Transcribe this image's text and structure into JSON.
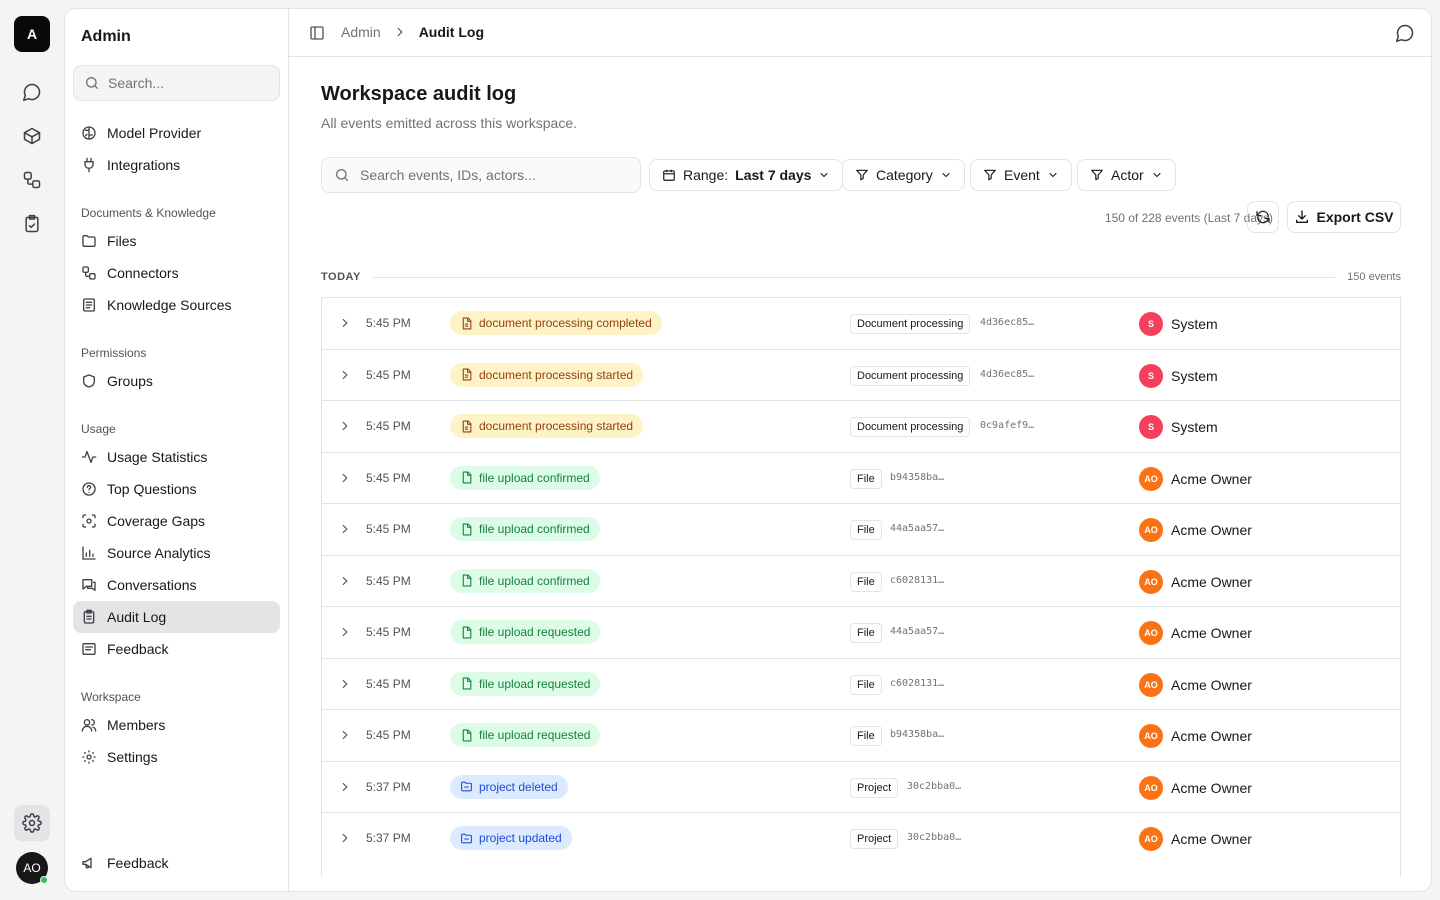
{
  "rail": {
    "logo": "A",
    "avatar": "AO"
  },
  "sidebar": {
    "title": "Admin",
    "search_placeholder": "Search...",
    "top_items": [
      {
        "label": "Model Provider",
        "icon": "brain-icon"
      },
      {
        "label": "Integrations",
        "icon": "plug-icon"
      }
    ],
    "groups": [
      {
        "label": "Documents & Knowledge",
        "items": [
          {
            "label": "Files",
            "icon": "folder-icon"
          },
          {
            "label": "Connectors",
            "icon": "connectors-icon"
          },
          {
            "label": "Knowledge Sources",
            "icon": "book-icon"
          }
        ]
      },
      {
        "label": "Permissions",
        "items": [
          {
            "label": "Groups",
            "icon": "shield-icon"
          }
        ]
      },
      {
        "label": "Usage",
        "items": [
          {
            "label": "Usage Statistics",
            "icon": "activity-icon"
          },
          {
            "label": "Top Questions",
            "icon": "question-icon"
          },
          {
            "label": "Coverage Gaps",
            "icon": "scan-icon"
          },
          {
            "label": "Source Analytics",
            "icon": "bar-chart-icon"
          },
          {
            "label": "Conversations",
            "icon": "messages-icon"
          },
          {
            "label": "Audit Log",
            "icon": "clipboard-icon",
            "active": true
          },
          {
            "label": "Feedback",
            "icon": "feedback-icon"
          }
        ]
      },
      {
        "label": "Workspace",
        "items": [
          {
            "label": "Members",
            "icon": "users-icon"
          },
          {
            "label": "Settings",
            "icon": "gear-icon"
          }
        ]
      }
    ],
    "footer_item": {
      "label": "Feedback",
      "icon": "megaphone-icon"
    }
  },
  "topbar": {
    "breadcrumb_parent": "Admin",
    "breadcrumb_current": "Audit Log"
  },
  "page": {
    "title": "Workspace audit log",
    "subtitle": "All events emitted across this workspace.",
    "search_placeholder": "Search events, IDs, actors...",
    "range_label": "Range:",
    "range_value": "Last 7 days",
    "category_label": "Category",
    "event_label": "Event",
    "actor_label": "Actor",
    "count_text": "150 of 228 events (Last 7 days)",
    "export_label": "Export CSV",
    "group_label": "TODAY",
    "group_count": "150 events"
  },
  "events": [
    {
      "time": "5:45 PM",
      "event": "document processing completed",
      "color": "yellow",
      "resource": "Document processing",
      "resource_id": "4d36ec85…",
      "actor": "System",
      "actor_initials": "S",
      "actor_kind": "sys"
    },
    {
      "time": "5:45 PM",
      "event": "document processing started",
      "color": "yellow",
      "resource": "Document processing",
      "resource_id": "4d36ec85…",
      "actor": "System",
      "actor_initials": "S",
      "actor_kind": "sys"
    },
    {
      "time": "5:45 PM",
      "event": "document processing started",
      "color": "yellow",
      "resource": "Document processing",
      "resource_id": "0c9afef9…",
      "actor": "System",
      "actor_initials": "S",
      "actor_kind": "sys"
    },
    {
      "time": "5:45 PM",
      "event": "file upload confirmed",
      "color": "green",
      "resource": "File",
      "resource_id": "b94358ba…",
      "actor": "Acme Owner",
      "actor_initials": "AO",
      "actor_kind": "ao"
    },
    {
      "time": "5:45 PM",
      "event": "file upload confirmed",
      "color": "green",
      "resource": "File",
      "resource_id": "44a5aa57…",
      "actor": "Acme Owner",
      "actor_initials": "AO",
      "actor_kind": "ao"
    },
    {
      "time": "5:45 PM",
      "event": "file upload confirmed",
      "color": "green",
      "resource": "File",
      "resource_id": "c6028131…",
      "actor": "Acme Owner",
      "actor_initials": "AO",
      "actor_kind": "ao"
    },
    {
      "time": "5:45 PM",
      "event": "file upload requested",
      "color": "green",
      "resource": "File",
      "resource_id": "44a5aa57…",
      "actor": "Acme Owner",
      "actor_initials": "AO",
      "actor_kind": "ao"
    },
    {
      "time": "5:45 PM",
      "event": "file upload requested",
      "color": "green",
      "resource": "File",
      "resource_id": "c6028131…",
      "actor": "Acme Owner",
      "actor_initials": "AO",
      "actor_kind": "ao"
    },
    {
      "time": "5:45 PM",
      "event": "file upload requested",
      "color": "green",
      "resource": "File",
      "resource_id": "b94358ba…",
      "actor": "Acme Owner",
      "actor_initials": "AO",
      "actor_kind": "ao"
    },
    {
      "time": "5:37 PM",
      "event": "project deleted",
      "color": "blue",
      "resource": "Project",
      "resource_id": "30c2bba0…",
      "actor": "Acme Owner",
      "actor_initials": "AO",
      "actor_kind": "ao"
    },
    {
      "time": "5:37 PM",
      "event": "project updated",
      "color": "blue",
      "resource": "Project",
      "resource_id": "30c2bba0…",
      "actor": "Acme Owner",
      "actor_initials": "AO",
      "actor_kind": "ao"
    }
  ]
}
